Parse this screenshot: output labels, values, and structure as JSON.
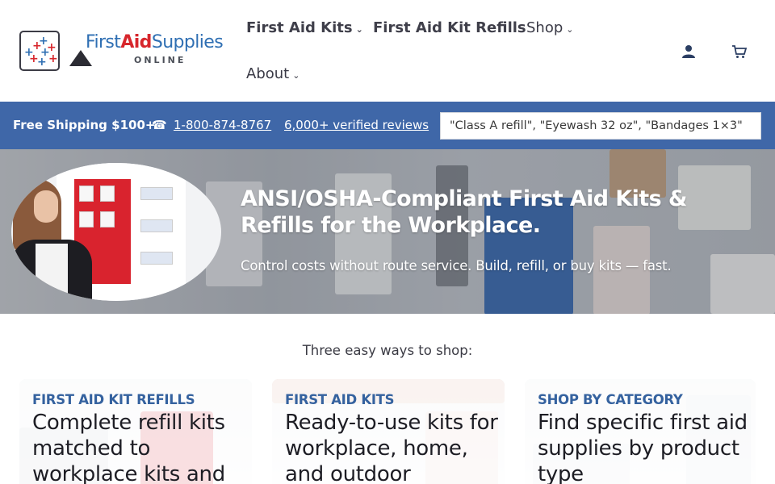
{
  "brand": {
    "logo_part1": "First",
    "logo_part2": "Aid",
    "logo_part3": "Supplies",
    "logo_sub": "ONLINE"
  },
  "nav": {
    "items": [
      {
        "label": "First Aid Kits",
        "has_dropdown": true
      },
      {
        "label": "First Aid Kit Refills",
        "has_dropdown": false
      },
      {
        "label": "Shop",
        "has_dropdown": true
      },
      {
        "label": "About",
        "has_dropdown": true
      }
    ],
    "chevron": "⌄",
    "account_icon": "user-icon",
    "cart_icon": "cart-icon"
  },
  "promo_bar": {
    "shipping": "Free Shipping $100+",
    "phone_icon": "☎",
    "phone": "1-800-874-8767",
    "reviews": "6,000+ verified reviews",
    "search_icon": "",
    "search_placeholder": "\"Class A refill\", \"Eyewash 32 oz\", \"Bandages 1×3\"",
    "color": "#3f67a8"
  },
  "hero": {
    "title": "ANSI/OSHA-Compliant First Aid Kits & Refills for the Workplace.",
    "subtitle": "Control costs without route service. Build, refill, or buy kits — fast."
  },
  "ways": {
    "heading": "Three easy ways to shop:",
    "cards": [
      {
        "eyebrow": "FIRST AID KIT REFILLS",
        "title": "Complete refill kits matched to workplace kits and"
      },
      {
        "eyebrow": "FIRST AID KITS",
        "title": "Ready-to-use kits for workplace, home, and outdoor"
      },
      {
        "eyebrow": "SHOP BY CATEGORY",
        "title": "Find specific first aid supplies by product type"
      }
    ]
  },
  "colors": {
    "accent_blue": "#35629f",
    "brand_red": "#d7262c"
  }
}
